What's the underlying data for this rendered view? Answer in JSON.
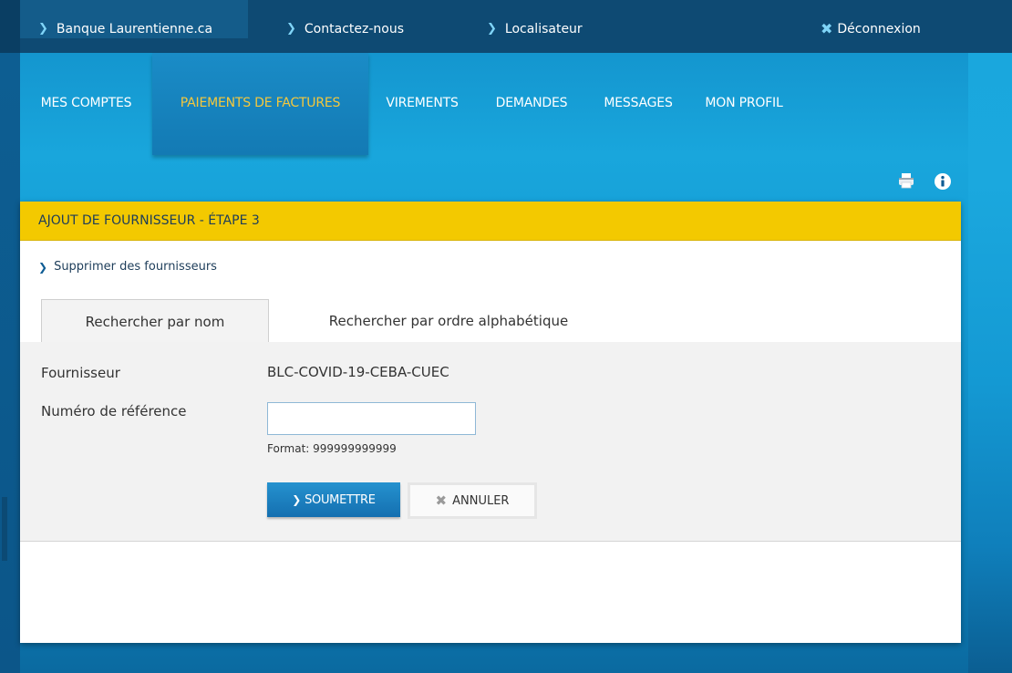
{
  "topbar": {
    "links": [
      {
        "label": "Banque Laurentienne.ca"
      },
      {
        "label": "Contactez-nous"
      },
      {
        "label": "Localisateur"
      }
    ],
    "logout_label": "Déconnexion"
  },
  "nav": {
    "items": [
      {
        "label": "MES COMPTES"
      },
      {
        "label": "PAIEMENTS DE FACTURES",
        "active": true
      },
      {
        "label": "VIREMENTS"
      },
      {
        "label": "DEMANDES"
      },
      {
        "label": "MESSAGES"
      },
      {
        "label": "MON PROFIL"
      }
    ]
  },
  "toolbar": {
    "icons": [
      "print-icon",
      "info-icon"
    ]
  },
  "panel": {
    "title": "AJOUT DE FOURNISSEUR - ÉTAPE 3",
    "delete_link": "Supprimer des fournisseurs",
    "tabs": [
      {
        "label": "Rechercher par nom",
        "active": true
      },
      {
        "label": "Rechercher par ordre alphabétique"
      }
    ],
    "form": {
      "supplier_label": "Fournisseur",
      "supplier_value": "BLC-COVID-19-CEBA-CUEC",
      "reference_label": "Numéro de référence",
      "reference_value": "",
      "reference_format": "Format: 999999999999"
    },
    "buttons": {
      "submit_label": "SOUMETTRE",
      "cancel_label": "ANNULER"
    }
  },
  "colors": {
    "topbar": "#0e4a73",
    "nav_bg": "#19a6dc",
    "active_nav_text": "#f5c83c",
    "header_yellow": "#f3c900",
    "submit_blue": "#1a7fbf"
  }
}
